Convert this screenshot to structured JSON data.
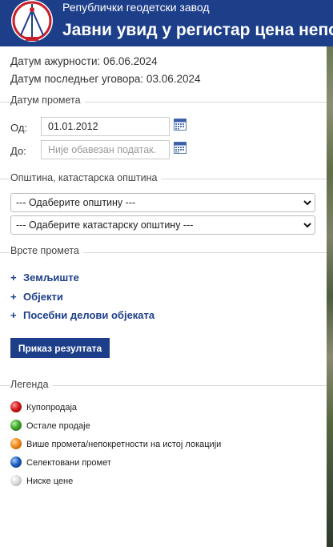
{
  "header": {
    "organization": "Републички геодетски завод",
    "title": "Јавни увид у регистар цена непокретности"
  },
  "info": {
    "update_date": "Датум ажурности: 06.06.2024",
    "last_contract_date": "Датум последњег уговора: 03.06.2024"
  },
  "date_section": {
    "label": "Датум промета",
    "from_label": "Од:",
    "from_value": "01.01.2012",
    "to_label": "До:",
    "to_placeholder": "Није обавезан податак."
  },
  "municipality_section": {
    "label": "Општина, катастарска општина",
    "municipality_selected": "--- Одаберите општину ---",
    "cadastral_selected": "--- Одаберите катастарску општину ---"
  },
  "types_section": {
    "label": "Врсте промета",
    "items": [
      {
        "plus": "+",
        "label": "Земљиште"
      },
      {
        "plus": "+",
        "label": "Објекти"
      },
      {
        "plus": "+",
        "label": "Посебни делови објеката"
      }
    ]
  },
  "show_results_button": "Приказ резултата",
  "legend": {
    "label": "Легенда",
    "items": [
      {
        "label": "Купопродаја",
        "color": "#d41a1a"
      },
      {
        "label": "Остале продаје",
        "color": "#3fa52a"
      },
      {
        "label": "Више промета/непокретности на истој локацији",
        "color": "#f28a1a"
      },
      {
        "label": "Селектовани промет",
        "color": "#1c5fc2"
      },
      {
        "label": "Ниске цене",
        "color": "#d8d8d8"
      }
    ]
  }
}
